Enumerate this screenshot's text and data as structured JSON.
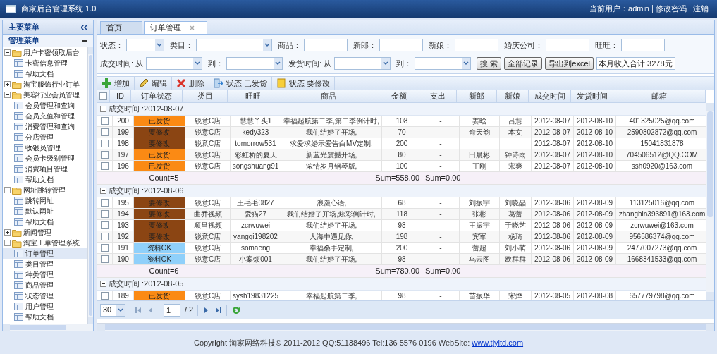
{
  "window": {
    "title": "商家后台管理系统 1.0"
  },
  "user_bar": {
    "user": "当前用户：admin",
    "links": [
      "修改密码",
      "注销"
    ]
  },
  "sidebar": {
    "title": "主要菜单",
    "section": "管理菜单",
    "tree": [
      {
        "label": "用户卡密领取后台",
        "expanded": true,
        "children": [
          {
            "label": "卡密信息管理",
            "selected": false
          },
          {
            "label": "帮助文档",
            "selected": false
          }
        ]
      },
      {
        "label": "淘宝服饰行业订单",
        "expanded": false
      },
      {
        "label": "美容行业会员管理",
        "expanded": true,
        "children": [
          {
            "label": "会员管理和查询",
            "selected": false
          },
          {
            "label": "会员充值和管理",
            "selected": false
          },
          {
            "label": "消费管理和查询",
            "selected": false
          },
          {
            "label": "分店管理",
            "selected": false
          },
          {
            "label": "收银员管理",
            "selected": false
          },
          {
            "label": "会员卡级别管理",
            "selected": false
          },
          {
            "label": "消费项目管理",
            "selected": false
          },
          {
            "label": "帮助文档",
            "selected": false
          }
        ]
      },
      {
        "label": "网址跳转管理",
        "expanded": true,
        "children": [
          {
            "label": "跳转网址",
            "selected": false
          },
          {
            "label": "默认网址",
            "selected": false
          },
          {
            "label": "帮助文档",
            "selected": false
          }
        ]
      },
      {
        "label": "新闻管理",
        "expanded": false
      },
      {
        "label": "淘宝工单管理系统",
        "expanded": true,
        "children": [
          {
            "label": "订单管理",
            "selected": true
          },
          {
            "label": "类目管理",
            "selected": false
          },
          {
            "label": "种类管理",
            "selected": false
          },
          {
            "label": "商品管理",
            "selected": false
          },
          {
            "label": "状态管理",
            "selected": false
          },
          {
            "label": "用户管理",
            "selected": false
          },
          {
            "label": "帮助文档",
            "selected": false
          }
        ]
      }
    ]
  },
  "tabs": [
    {
      "label": "首页",
      "selected": false,
      "closable": false
    },
    {
      "label": "订单管理",
      "selected": true,
      "closable": true
    }
  ],
  "filters": [
    [
      {
        "label": "状态：",
        "kind": "select"
      },
      {
        "label": "类目：",
        "kind": "select"
      },
      {
        "label": "商品：",
        "kind": "input"
      },
      {
        "label": "新郎：",
        "kind": "input"
      },
      {
        "label": "新娘：",
        "kind": "input"
      },
      {
        "label": "婚庆公司：",
        "kind": "input"
      },
      {
        "label": "旺旺：",
        "kind": "input"
      }
    ],
    [
      {
        "label": "成交时间: 从",
        "kind": "select"
      },
      {
        "label": "到：",
        "kind": "select"
      },
      {
        "label": "发货时间: 从",
        "kind": "select"
      },
      {
        "label": "到：",
        "kind": "select"
      }
    ]
  ],
  "filter_buttons": [
    "搜 索",
    "全部记录",
    "导出到excel"
  ],
  "month_income": "本月收入合计:3278元",
  "toolbar": [
    "增加",
    "编辑",
    "删除",
    "状态 已发货",
    "状态 要修改"
  ],
  "table": {
    "header_checked": false,
    "columns": [
      "ID",
      "订单状态",
      "类目",
      "旺旺",
      "商品",
      "金额",
      "支出",
      "新郎",
      "新娘",
      "成交时间",
      "发货时间",
      "邮箱"
    ],
    "groups": [
      {
        "label": "成交时间 :2012-08-07",
        "expanded": true,
        "count": "Count=5",
        "sum_amount": "Sum=558.00",
        "sum_expense": "Sum=0.00",
        "rows": [
          {
            "checked": false,
            "cells": [
              "200",
              "已发货",
              "锐意C店",
              "慧慧丫头1",
              "幸福起航第二季,第二季倒计时,",
              "108",
              "-",
              "姜晗",
              "吕慧",
              "2012-08-07",
              "2012-08-10",
              "401325025@qq.com"
            ],
            "color": "#fb8a14"
          },
          {
            "checked": false,
            "cells": [
              "199",
              "要修改",
              "锐意C店",
              "kedy323",
              "我们结婚了开场,",
              "70",
              "-",
              "俞天韵",
              "本文",
              "2012-08-07",
              "2012-08-10",
              "2590802872@qq.com"
            ],
            "color": "#8b4513"
          },
          {
            "checked": false,
            "cells": [
              "198",
              "要修改",
              "锐意C店",
              "tomorrow531",
              "求爱求婚示爱告白MV定制,",
              "200",
              "-",
              "",
              "",
              "2012-08-07",
              "2012-08-10",
              "15041831878"
            ],
            "color": "#8b4513"
          },
          {
            "checked": false,
            "cells": [
              "197",
              "已发货",
              "锐意C店",
              "彩虹桥的夏天",
              "新蓝光震撼开场,",
              "80",
              "-",
              "田晨彬",
              "钟诗雨",
              "2012-08-07",
              "2012-08-10",
              "704506512@QQ.COM"
            ],
            "color": "#fb8a14"
          },
          {
            "checked": false,
            "cells": [
              "196",
              "已发货",
              "锐意C店",
              "songshuang91",
              "浓情岁月钢琴版,",
              "100",
              "-",
              "王刚",
              "宋爽",
              "2012-08-07",
              "2012-08-10",
              "ssh0920@163.com"
            ],
            "color": "#fb8a14"
          }
        ]
      },
      {
        "label": "成交时间 :2012-08-06",
        "expanded": true,
        "count": "Count=6",
        "sum_amount": "Sum=780.00",
        "sum_expense": "Sum=0.00",
        "rows": [
          {
            "checked": false,
            "cells": [
              "195",
              "要修改",
              "锐意C店",
              "王毛毛0827",
              "浪漫心语,",
              "68",
              "-",
              "刘振宇",
              "刘晓晶",
              "2012-08-06",
              "2012-08-09",
              "113125016@qq.com"
            ],
            "color": "#8b4513"
          },
          {
            "checked": false,
            "cells": [
              "194",
              "要修改",
              "曲乔视频",
              "爱猫27",
              "我们结婚了开场,炫彩倒计时,",
              "118",
              "-",
              "张彬",
              "葛蕾",
              "2012-08-06",
              "2012-08-09",
              "zhangbin393891@163.com"
            ],
            "color": "#8b4513"
          },
          {
            "checked": false,
            "cells": [
              "193",
              "要修改",
              "顺昌视频",
              "zcrwuwei",
              "我们结婚了开场,",
              "98",
              "-",
              "王振宇",
              "于晓艺",
              "2012-08-06",
              "2012-08-09",
              "zcrwuwei@163.com"
            ],
            "color": "#8b4513"
          },
          {
            "checked": false,
            "cells": [
              "192",
              "要修改",
              "锐意C店",
              "yangqi198202",
              "人海中遇见你,",
              "198",
              "-",
              "宾军",
              "杨琦",
              "2012-08-06",
              "2012-08-09",
              "956586374@qq.com"
            ],
            "color": "#8b4513"
          },
          {
            "checked": false,
            "cells": [
              "191",
              "资料OK",
              "锐意C店",
              "somaeng",
              "幸福桑手定制,",
              "200",
              "-",
              "蕾超",
              "刘小萌",
              "2012-08-06",
              "2012-08-09",
              "2477007273@qq.com"
            ],
            "color": "#8fd0fa"
          },
          {
            "checked": false,
            "cells": [
              "190",
              "资料OK",
              "锐意C店",
              "小案烦001",
              "我们结婚了开场,",
              "98",
              "-",
              "乌云图",
              "欧群群",
              "2012-08-06",
              "2012-08-09",
              "1668341533@qq.com"
            ],
            "color": "#8fd0fa"
          }
        ]
      },
      {
        "label": "成交时间 :2012-08-05",
        "expanded": true,
        "rows": [
          {
            "checked": false,
            "cells": [
              "189",
              "已发货",
              "锐意C店",
              "sysh19831225",
              "幸福起航第二季,",
              "98",
              "-",
              "苗振华",
              "宋烨",
              "2012-08-05",
              "2012-08-08",
              "657779798@qq.com"
            ],
            "color": "#fb8a14"
          }
        ]
      }
    ]
  },
  "pager": {
    "page_size": "30",
    "page": "1",
    "total": "/ 2"
  },
  "footer": {
    "text": "Copyright 淘家网络科技© 2011-2012 QQ:51138496 Tel:136 5576 0196 WebSite:",
    "link": "www.tjyltd.com"
  }
}
